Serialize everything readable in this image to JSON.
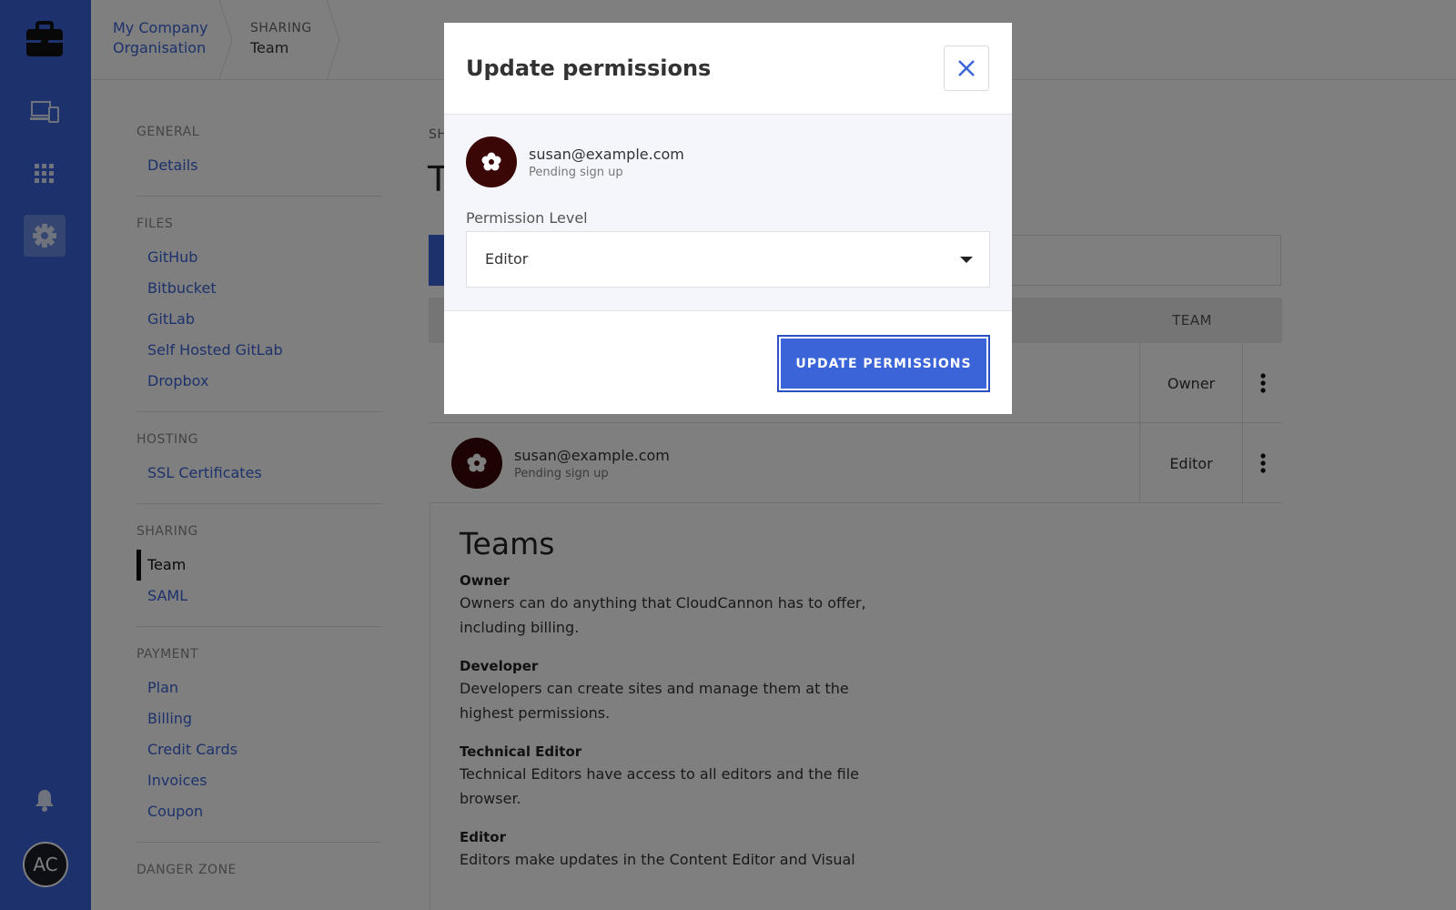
{
  "breadcrumb": {
    "org_line1": "My Company",
    "org_line2": "Organisation",
    "section_label": "SHARING",
    "section_current": "Team"
  },
  "rail": {
    "icons": [
      "briefcase-icon",
      "devices-icon",
      "apps-grid-icon",
      "settings-gear-icon",
      "bell-icon"
    ],
    "avatar_initials": "AC"
  },
  "nav": {
    "groups": [
      {
        "heading": "GENERAL",
        "items": [
          "Details"
        ]
      },
      {
        "heading": "FILES",
        "items": [
          "GitHub",
          "Bitbucket",
          "GitLab",
          "Self Hosted GitLab",
          "Dropbox"
        ]
      },
      {
        "heading": "HOSTING",
        "items": [
          "SSL Certificates"
        ]
      },
      {
        "heading": "SHARING",
        "items": [
          "Team",
          "SAML"
        ],
        "active": "Team"
      },
      {
        "heading": "PAYMENT",
        "items": [
          "Plan",
          "Billing",
          "Credit Cards",
          "Invoices",
          "Coupon"
        ]
      },
      {
        "heading": "DANGER ZONE",
        "items": []
      }
    ]
  },
  "main": {
    "section_label_partial": "SH",
    "title_partial": "T",
    "table": {
      "team_header": "TEAM",
      "rows": [
        {
          "email": "",
          "status": "",
          "role": "Owner"
        },
        {
          "email": "susan@example.com",
          "status": "Pending sign up",
          "role": "Editor"
        }
      ]
    },
    "teams_info": {
      "title": "Teams",
      "roles": [
        {
          "name": "Owner",
          "description": "Owners can do anything that CloudCannon has to offer, including billing."
        },
        {
          "name": "Developer",
          "description": "Developers can create sites and manage them at the highest permissions."
        },
        {
          "name": "Technical Editor",
          "description": "Technical Editors have access to all editors and the file browser."
        },
        {
          "name": "Editor",
          "description": "Editors make updates in the Content Editor and Visual"
        }
      ]
    }
  },
  "modal": {
    "title": "Update permissions",
    "user_email": "susan@example.com",
    "user_status": "Pending sign up",
    "permission_label": "Permission Level",
    "permission_value": "Editor",
    "submit_label": "UPDATE PERMISSIONS"
  },
  "colors": {
    "brand_blue": "#3a64d8",
    "avatar_dark": "#3a0606"
  }
}
